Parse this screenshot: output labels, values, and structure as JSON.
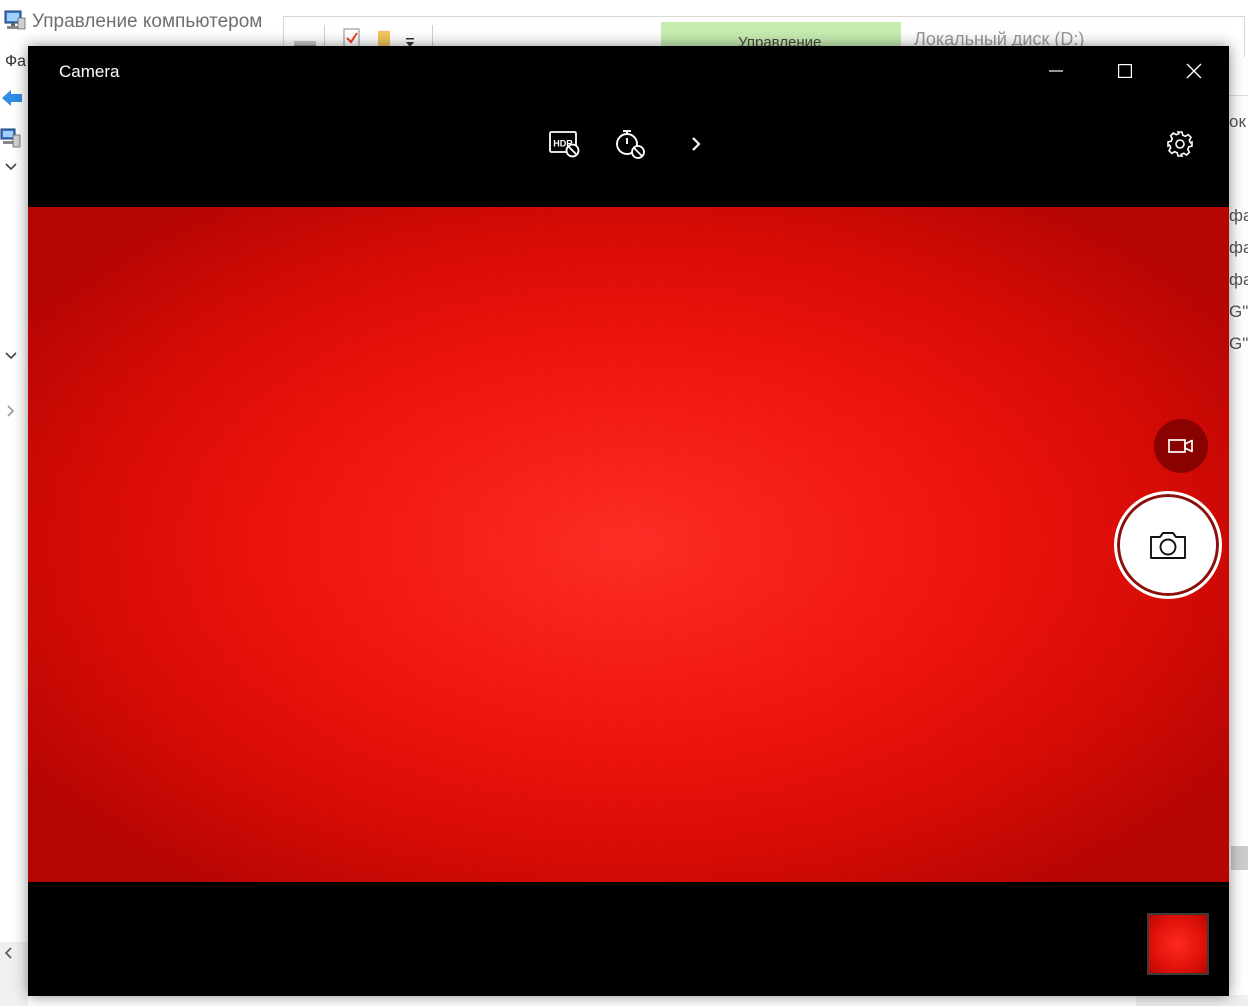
{
  "background_window": {
    "title": "Управление компьютером",
    "file_menu": "Фа",
    "ribbon": {
      "manage_tab_label": "Управление",
      "drive_title": "Локальный диск (D:)",
      "manage_tab_color": "#c6ecb0"
    },
    "right_pane_fragments": [
      "ок",
      "фа",
      "фа",
      "фа",
      "G\"",
      "G\""
    ],
    "tree_chevrons": [
      "chevron-down-icon",
      "chevron-down-icon",
      "chevron-right-icon"
    ]
  },
  "camera": {
    "title": "Camera",
    "window_controls": {
      "minimize": "minimize-icon",
      "maximize": "maximize-icon",
      "close": "close-icon"
    },
    "toolbar": {
      "hdr": "hdr-off-icon",
      "timer": "timer-off-icon",
      "more": "chevron-right-icon",
      "settings": "gear-icon"
    },
    "mode_buttons": {
      "video": "video-camera-icon",
      "photo": "camera-icon"
    },
    "colors": {
      "viewfinder": "#f2140c",
      "chrome": "#000000",
      "shutter_ring": "#8b0f0a"
    }
  }
}
